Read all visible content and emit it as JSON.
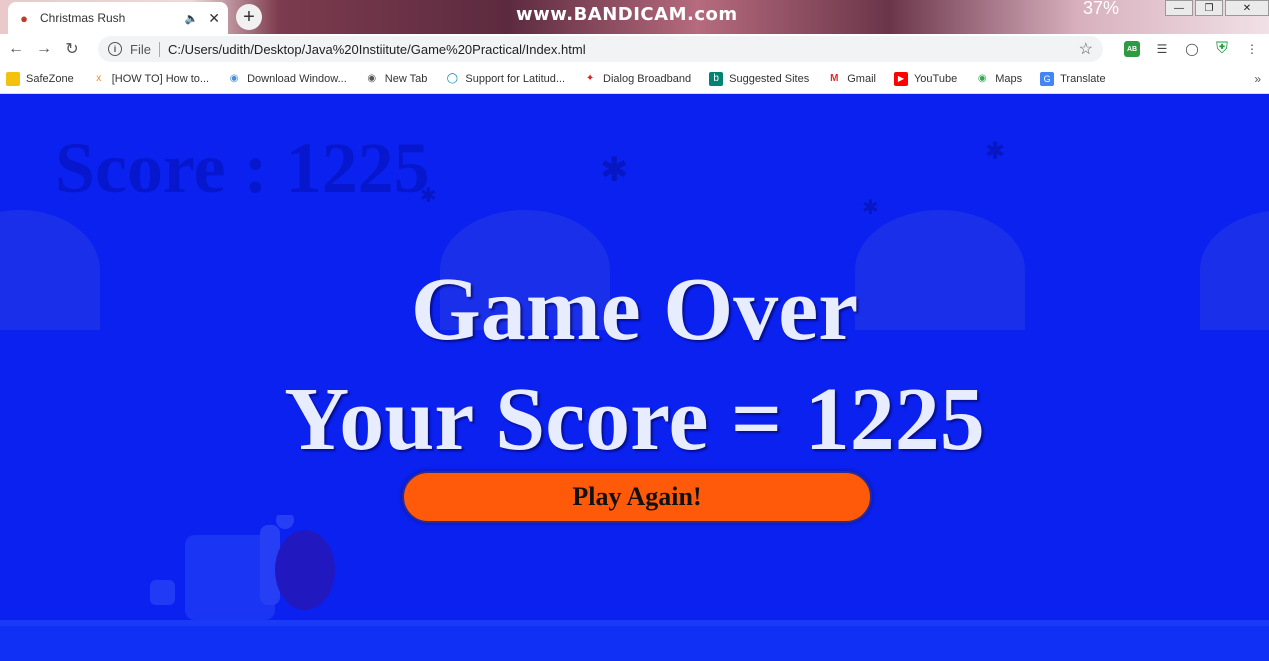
{
  "tab": {
    "title": "Christmas Rush",
    "favicon": "santa-icon",
    "audio_icon": "speaker-icon"
  },
  "watermark": "www.BANDICAM.com",
  "battery_percent": "37%",
  "omnibox": {
    "scheme": "File",
    "url": "C:/Users/udith/Desktop/Java%20Instiitute/Game%20Practical/Index.html"
  },
  "bookmarks": [
    {
      "label": "SafeZone",
      "icon": "folder-icon",
      "color": "#f4c20d"
    },
    {
      "label": "[HOW TO] How to...",
      "icon": "xda-icon",
      "color": "#f08a24"
    },
    {
      "label": "Download Window...",
      "icon": "globe-icon",
      "color": "#4a8fd6"
    },
    {
      "label": "New Tab",
      "icon": "globe-icon",
      "color": "#555555"
    },
    {
      "label": "Support for Latitud...",
      "icon": "dell-icon",
      "color": "#007db8"
    },
    {
      "label": "Dialog Broadband",
      "icon": "dialog-icon",
      "color": "#d9261c"
    },
    {
      "label": "Suggested Sites",
      "icon": "bing-icon",
      "color": "#008373"
    },
    {
      "label": "Gmail",
      "icon": "gmail-icon",
      "color": "#d93025"
    },
    {
      "label": "YouTube",
      "icon": "youtube-icon",
      "color": "#ff0000"
    },
    {
      "label": "Maps",
      "icon": "maps-icon",
      "color": "#34a853"
    },
    {
      "label": "Translate",
      "icon": "translate-icon",
      "color": "#4285f4"
    }
  ],
  "game": {
    "background_score": "Score : 1225",
    "title": "Game Over",
    "score_line": "Your Score = 1225",
    "play_again": "Play Again!"
  },
  "colors": {
    "game_bg": "#0b21f0",
    "button": "#ff5a0a",
    "text": "#e8ecff"
  }
}
